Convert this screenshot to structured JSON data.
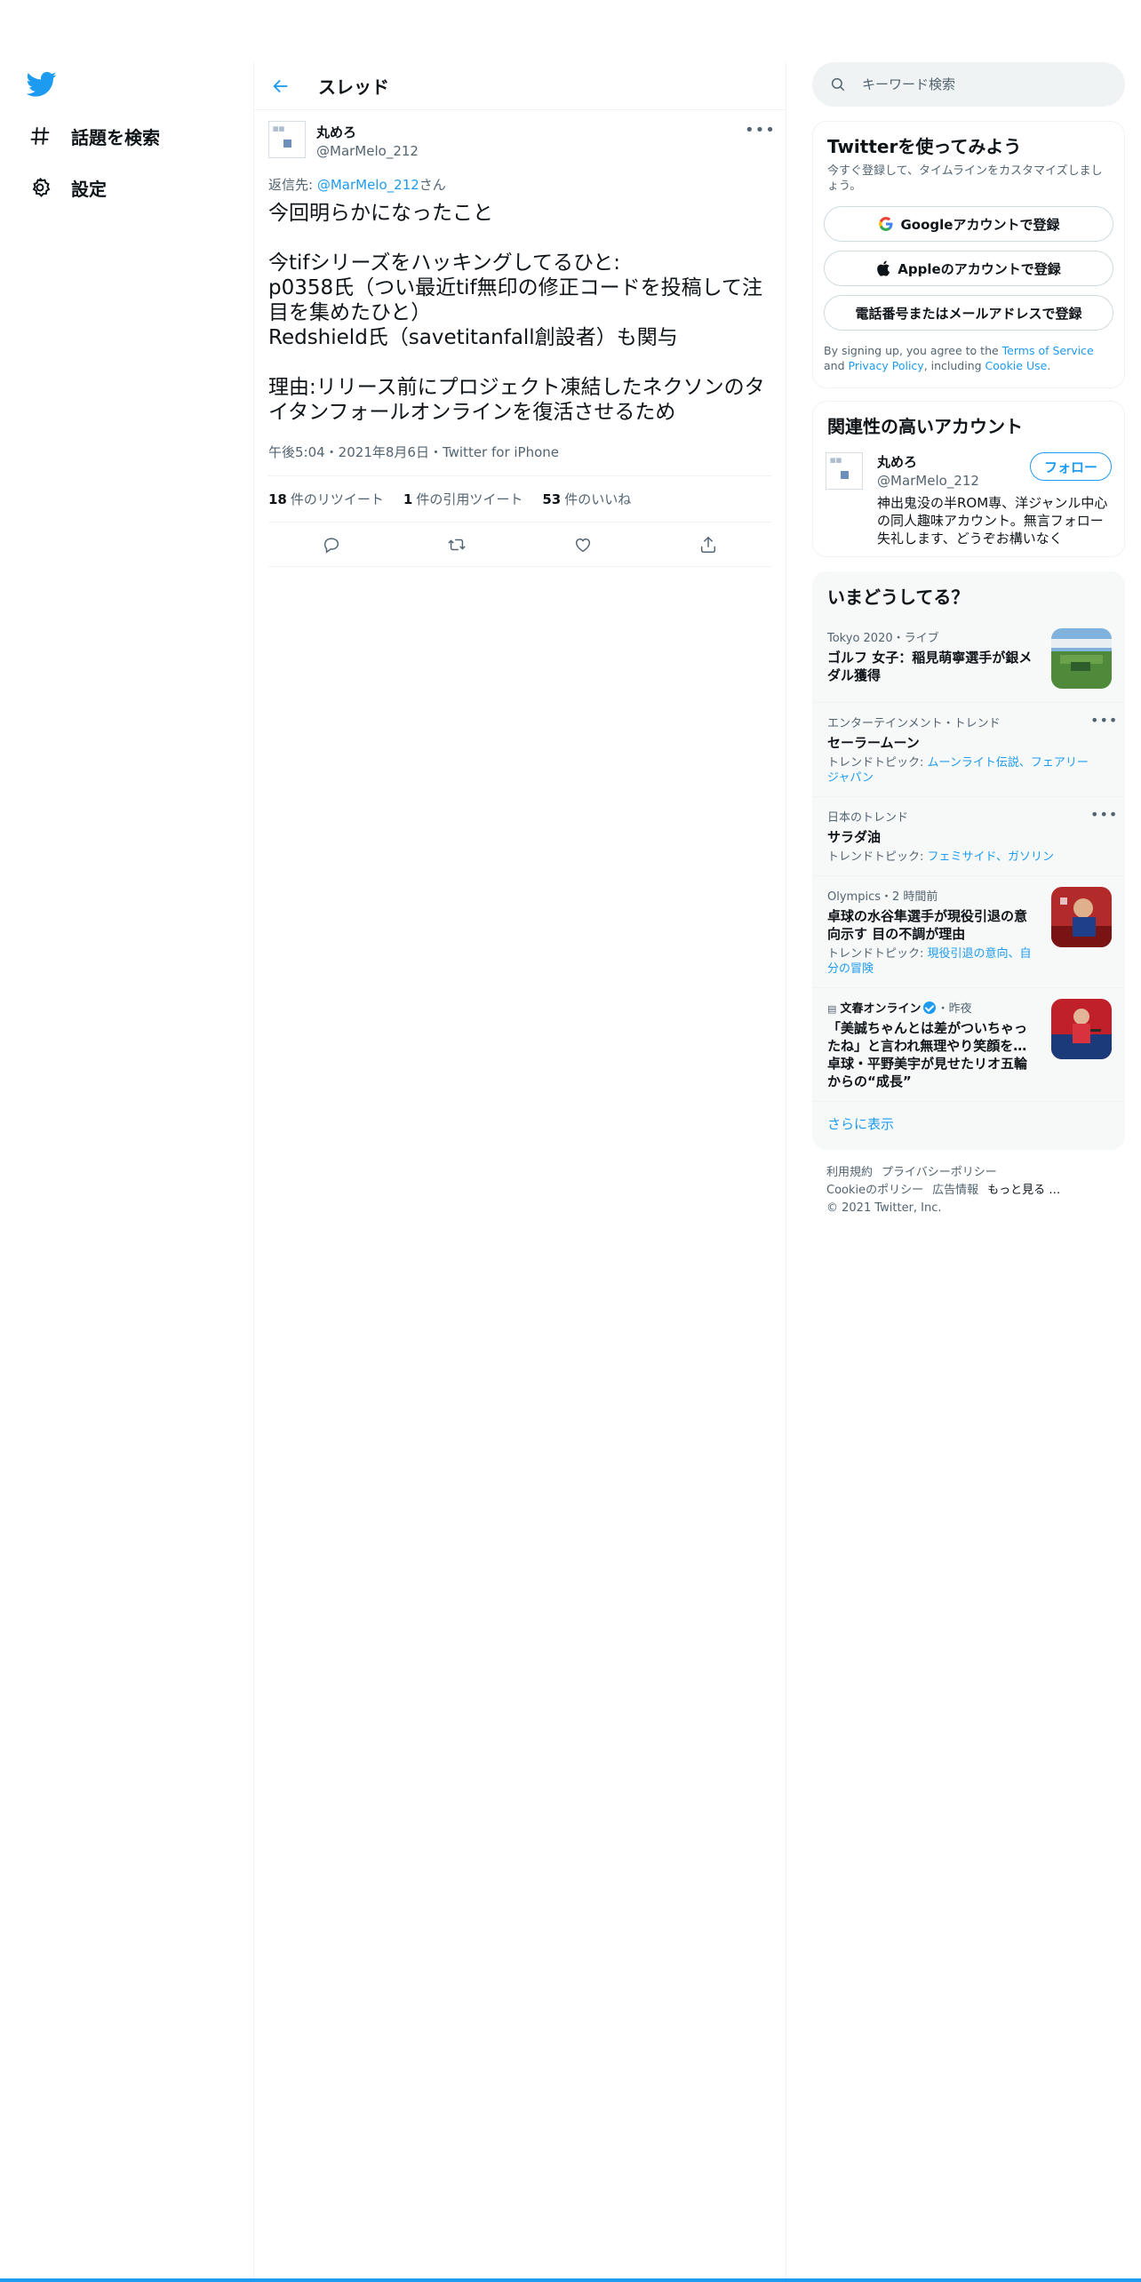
{
  "nav": {
    "items": [
      {
        "label": "話題を検索",
        "icon": "hashtag-icon"
      },
      {
        "label": "設定",
        "icon": "gear-icon"
      }
    ]
  },
  "header": {
    "title": "スレッド"
  },
  "tweet": {
    "display_name": "丸めろ",
    "handle": "@MarMelo_212",
    "reply_prefix": "返信先: ",
    "reply_handle": "@MarMelo_212",
    "reply_suffix": "さん",
    "text": "今回明らかになったこと\n\n今tifシリーズをハッキングしてるひと:\np0358氏（つい最近tif無印の修正コードを投稿して注目を集めたひと）\nRedshield氏（savetitanfall創設者）も関与\n\n理由:リリース前にプロジェクト凍結したネクソンのタイタンフォールオンラインを復活させるため",
    "meta": "午後5:04・2021年8月6日・Twitter for iPhone",
    "stats": {
      "retweets_count": "18",
      "retweets_label": "件のリツイート",
      "quotes_count": "1",
      "quotes_label": "件の引用ツイート",
      "likes_count": "53",
      "likes_label": "件のいいね"
    }
  },
  "search": {
    "placeholder": "キーワード検索"
  },
  "signup": {
    "title": "Twitterを使ってみよう",
    "desc": "今すぐ登録して、タイムラインをカスタマイズしましょう。",
    "google_btn": "Googleアカウントで登録",
    "apple_btn": "Appleのアカウントで登録",
    "phone_btn": "電話番号またはメールアドレスで登録",
    "legal_1": "By signing up, you agree to the ",
    "terms": "Terms of Service",
    "legal_2": " and ",
    "privacy": "Privacy Policy",
    "legal_3": ", including ",
    "cookie": "Cookie Use",
    "legal_4": "."
  },
  "related": {
    "title": "関連性の高いアカウント",
    "name": "丸めろ",
    "handle": "@MarMelo_212",
    "follow": "フォロー",
    "bio": "神出鬼没の半ROM専、洋ジャンル中心の同人趣味アカウント。無言フォロー失礼します、どうぞお構いなく"
  },
  "trends": {
    "title": "いまどうしてる？",
    "items": [
      {
        "meta": "Tokyo 2020・ライブ",
        "title": "ゴルフ 女子：稲見萌寧選手が銀メダル獲得",
        "topics_prefix": "",
        "topics": ""
      },
      {
        "meta": "エンターテインメント・トレンド",
        "title": "セーラームーン",
        "topics_prefix": "トレンドトピック: ",
        "topics": "ムーンライト伝説、フェアリージャパン"
      },
      {
        "meta": "日本のトレンド",
        "title": "サラダ油",
        "topics_prefix": "トレンドトピック: ",
        "topics": "フェミサイド、ガソリン"
      },
      {
        "meta": "Olympics・2 時間前",
        "title": "卓球の水谷隼選手が現役引退の意向示す 目の不調が理由",
        "topics_prefix": "トレンドトピック: ",
        "topics": "現役引退の意向、自分の冒険"
      },
      {
        "meta_source": "文春オンライン",
        "meta_time": "・昨夜",
        "title": "「美誠ちゃんとは差がついちゃったね」と言われ無理やり笑顔を… 卓球・平野美宇が見せたリオ五輪からの“成長”"
      }
    ],
    "show_more": "さらに表示"
  },
  "footer": {
    "links": [
      "利用規約",
      "プライバシーポリシー",
      "Cookieのポリシー",
      "広告情報",
      "もっと見る …"
    ],
    "copyright": "© 2021 Twitter, Inc."
  },
  "colors": {
    "accent": "#1d9bf0",
    "text": "#0f1419",
    "muted": "#536471",
    "border": "#eff3f4"
  }
}
